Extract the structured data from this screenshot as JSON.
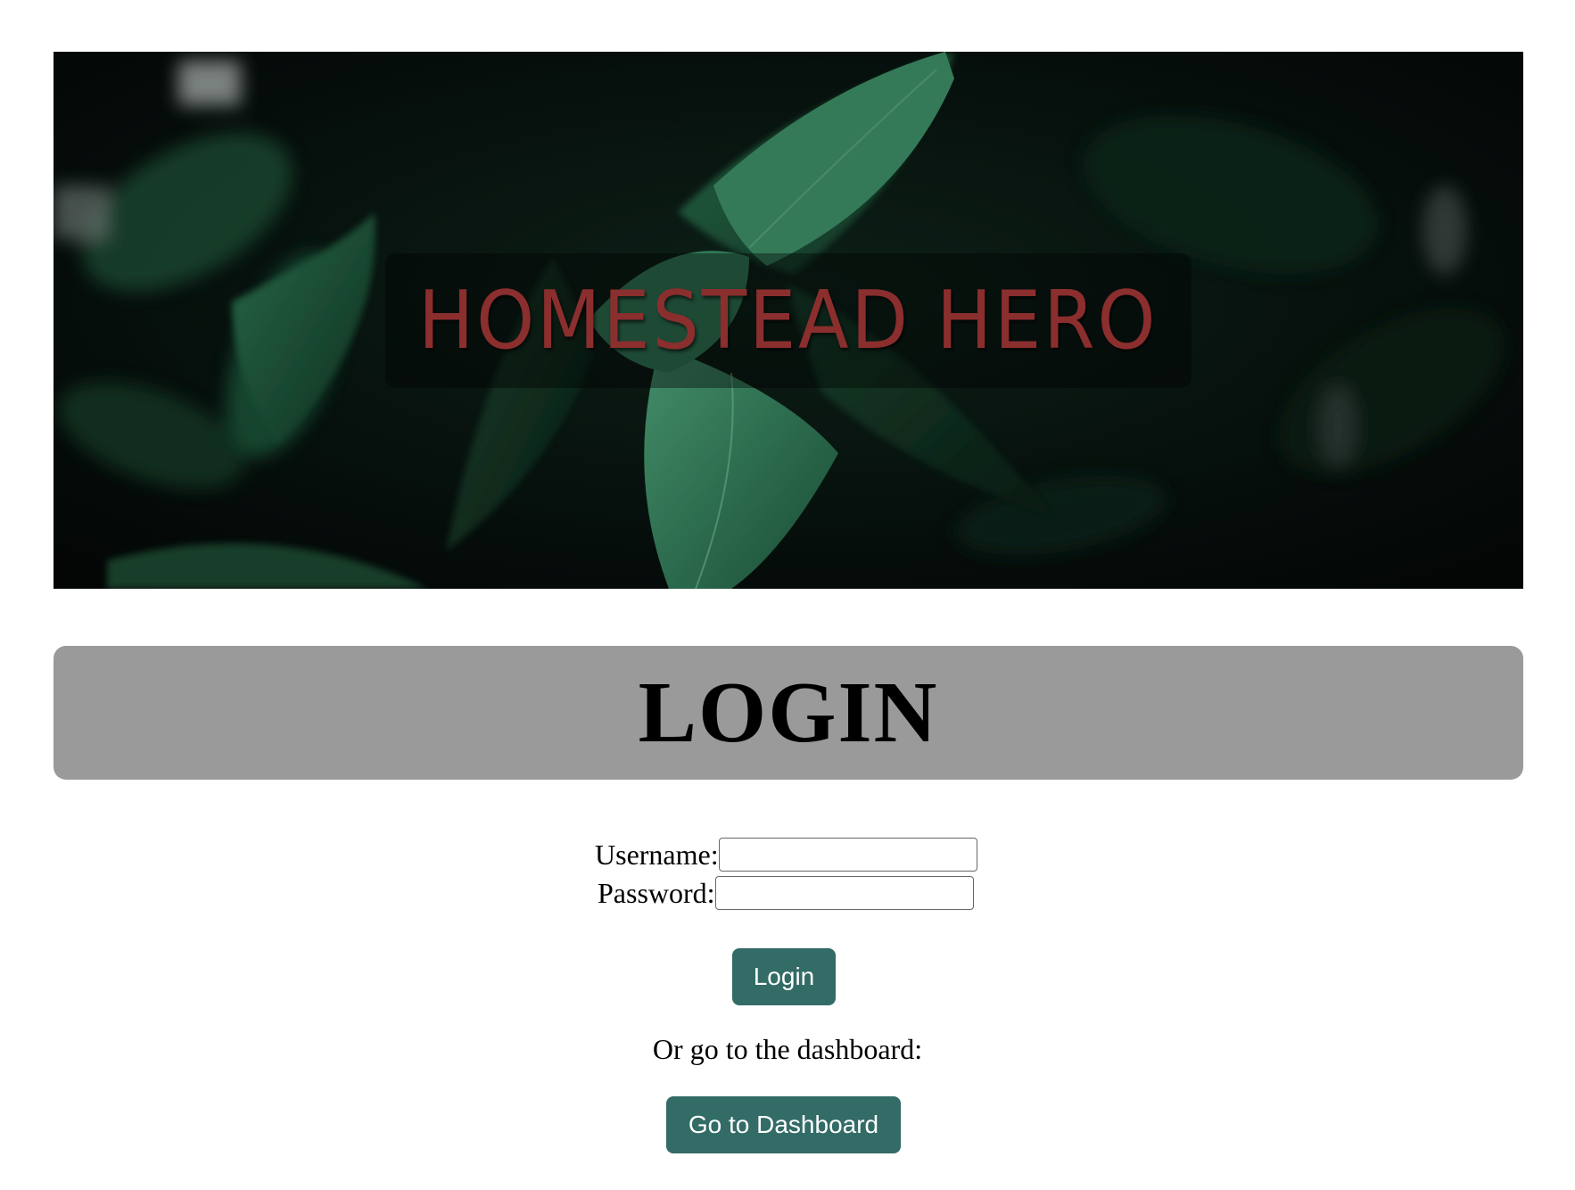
{
  "hero": {
    "title": "HOMESTEAD HERO",
    "title_color": "#8b2e2e"
  },
  "login_banner": {
    "heading": "LOGIN",
    "background_color": "#9a9a9a"
  },
  "form": {
    "username_label": "Username:",
    "username_value": "",
    "password_label": "Password:",
    "password_value": "",
    "login_button_label": "Login",
    "button_color": "#336b66"
  },
  "dashboard": {
    "prompt_text": "Or go to the dashboard:",
    "button_label": "Go to Dashboard"
  }
}
